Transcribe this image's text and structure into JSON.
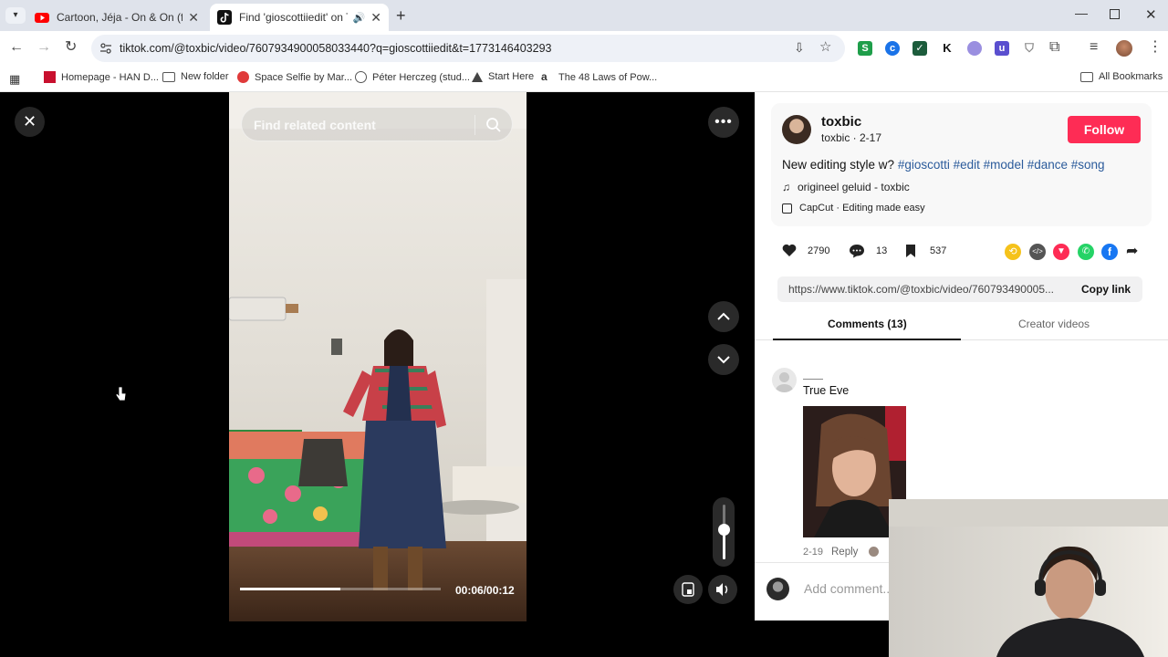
{
  "browser": {
    "tabs": [
      {
        "title": "Cartoon, Jéja - On & On (feat. D",
        "favicon": "youtube-icon"
      },
      {
        "title": "Find 'gioscottiiedit' on TikTok",
        "favicon": "tiktok-icon"
      }
    ],
    "url": "tiktok.com/@toxbic/video/7607934900058033440?q=gioscottiiedit&t=1773146403293",
    "bookmarks": [
      {
        "label": "Homepage - HAN D..."
      },
      {
        "label": "New folder"
      },
      {
        "label": "Space Selfie by Mar..."
      },
      {
        "label": "Péter Herczeg (stud..."
      },
      {
        "label": "Start Here"
      },
      {
        "label": "The 48 Laws of Pow..."
      }
    ],
    "all_bookmarks": "All Bookmarks"
  },
  "video": {
    "search_placeholder": "Find related content",
    "time": "00:06/00:12",
    "progress": 0.5,
    "volume": 0.55
  },
  "post": {
    "username": "toxbic",
    "subline": "toxbic · 2-17",
    "follow_label": "Follow",
    "caption_text": "New editing style w? ",
    "hashtags": [
      "#gioscotti",
      "#edit",
      "#model",
      "#dance",
      "#song"
    ],
    "sound": "origineel geluid - toxbic",
    "capcut": "CapCut · Editing made easy",
    "likes": "2790",
    "comments": "13",
    "saves": "537",
    "link": "https://www.tiktok.com/@toxbic/video/760793490005...",
    "copy_link": "Copy link"
  },
  "tabs": {
    "comments": "Comments (13)",
    "creator": "Creator videos"
  },
  "comment": {
    "author": "True Eve",
    "date": "2-19",
    "reply": "Reply"
  },
  "add_comment_placeholder": "Add comment...",
  "colors": {
    "follow": "#fe2c55",
    "hashtag": "#2b5b9b"
  }
}
